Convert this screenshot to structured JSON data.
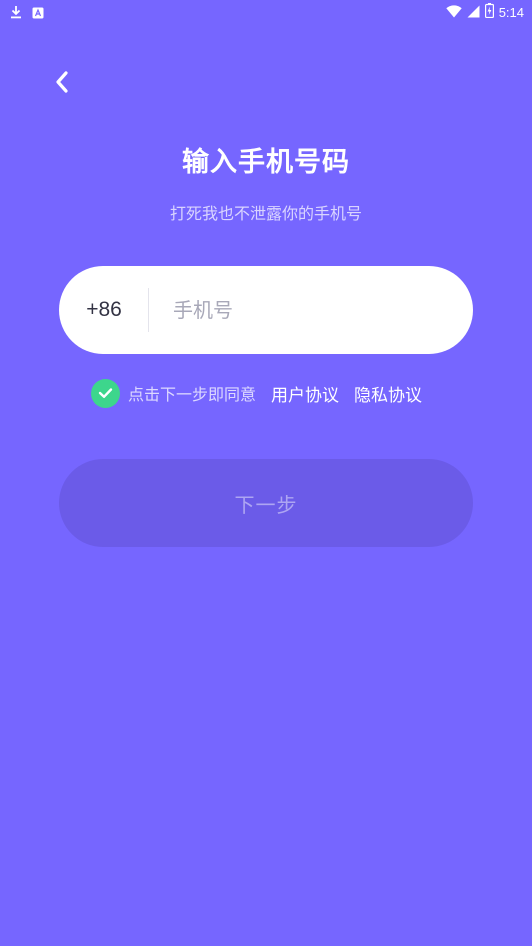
{
  "status_bar": {
    "time": "5:14",
    "icons": [
      "download-icon",
      "app-notification-icon",
      "wifi-icon",
      "cell-signal-icon",
      "battery-icon"
    ]
  },
  "header": {
    "back_icon": "chevron-left-icon",
    "title": "输入手机号码",
    "subtitle": "打死我也不泄露你的手机号"
  },
  "phone": {
    "country_code": "+86",
    "placeholder": "手机号",
    "value": ""
  },
  "agreement": {
    "checked": true,
    "prefix": "点击下一步即同意",
    "user_agreement": "用户协议",
    "privacy_policy": "隐私协议"
  },
  "next_button": {
    "label": "下一步",
    "enabled": false
  },
  "colors": {
    "background": "#7666FF",
    "button_disabled": "#6B5BE8",
    "check": "#3DD68C",
    "input_bg": "#FFFFFF"
  }
}
